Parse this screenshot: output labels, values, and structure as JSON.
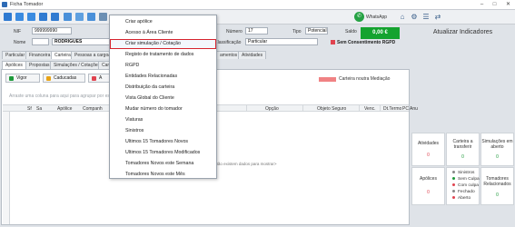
{
  "window": {
    "title": "Ficha Tomador",
    "minimize": "–",
    "maximize": "□",
    "close": "✕"
  },
  "toolbar": {
    "whatsapp_label": "WhatsApp",
    "whatsapp_glyph": "✆",
    "tools": [
      "⌂",
      "⚙",
      "☰",
      "⇄"
    ]
  },
  "form": {
    "nif_label": "NIF",
    "nif_value": "999999990",
    "nome_label": "Nome",
    "nome_value": "RODRIGUES",
    "numero_label": "Número",
    "numero_value": "17",
    "tipo_label": "Tipo",
    "tipo_value": "Potencial",
    "saldo_label": "Saldo",
    "saldo_value": "0,00 €",
    "classificacao_label": "Classificação",
    "classificacao_value": "Particular",
    "sem_consentimento": "Sem Consentimento RGPD"
  },
  "tabs_main": [
    "Particular",
    "Financeira",
    "Carteira",
    "Pessoas a cargo/C",
    "amentos",
    "Atividades"
  ],
  "tabs_sub": [
    "Apólices",
    "Propostas",
    "Simulações / Cotações",
    "Cart"
  ],
  "filters": {
    "vigor": "Vigor",
    "caducadas": "Caducadas",
    "anuladas": "A"
  },
  "legend_label": "Carteira noutra Mediação",
  "group_hint": "Arraste uma coluna para aqui para agrupar por essa coluna",
  "grid_columns": [
    "Sf",
    "Sa",
    "Apólice",
    "Companh",
    "Opção",
    "Objeto Seguro",
    "Venc.",
    "Dt.Termo",
    "PC Anu"
  ],
  "grid_empty": "<Não existem dados para mostrar>",
  "context_menu": {
    "items": [
      "Criar apólice",
      "Acesso à Área Cliente",
      "Criar simulação / Cotação",
      "Registo de tratamento de dados",
      "RGPD",
      "Entidades Relacionadas",
      "Distribuição da carteira",
      "Vista Global do Cliente",
      "Mudar número do tomador",
      "Viaturas",
      "Sinistros",
      "Ultimos 15 Tomadores Novos",
      "Ultimos 15 Tomadores Modificados",
      "Tomadores Novos este Semana",
      "Tomadores Novos este Mês"
    ],
    "highlighted_index": 2
  },
  "right_panel": {
    "title": "Atualizar Indicadores",
    "cards": [
      {
        "title": "Atividades",
        "value": "0",
        "color": "#e0434f"
      },
      {
        "title": "Carteira a transferir",
        "value": "0",
        "color": "#1d9a3a"
      },
      {
        "title": "Simulações em aberto",
        "value": "0",
        "color": "#1d9a3a"
      },
      {
        "title": "Apólices",
        "value": "0",
        "color": "#e0434f"
      },
      {
        "title": "Tomadores Relacionados",
        "value": "0",
        "color": "#1d9a3a"
      }
    ],
    "sinistros_legend": [
      {
        "label": "Sinistros",
        "color": "#888888"
      },
      {
        "label": "Sem Culpa",
        "color": "#1d9a3a"
      },
      {
        "label": "Com culpa",
        "color": "#e0434f"
      },
      {
        "label": "Fechado",
        "color": "#888888"
      },
      {
        "label": "Aberto",
        "color": "#e0434f"
      }
    ]
  }
}
